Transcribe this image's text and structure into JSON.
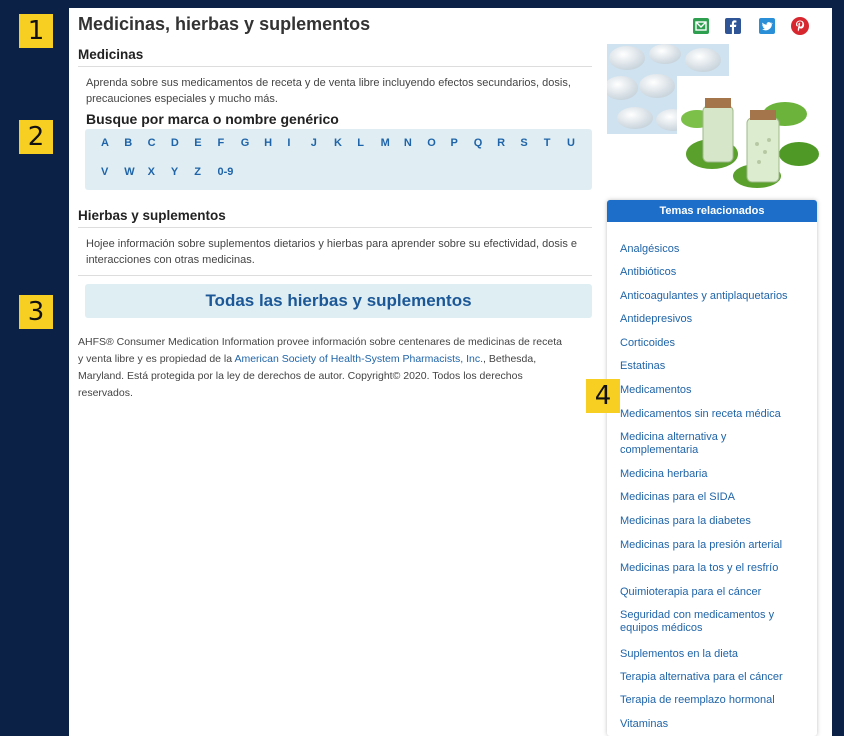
{
  "page": {
    "title": "Medicinas, hierbas y suplementos"
  },
  "markers": [
    "1",
    "2",
    "3",
    "4"
  ],
  "share_icons": [
    {
      "icon": "email-icon",
      "color": "#2e9e4f"
    },
    {
      "icon": "facebook-icon",
      "color": "#2f5597"
    },
    {
      "icon": "twitter-icon",
      "color": "#2b8fd8"
    },
    {
      "icon": "pinterest-icon",
      "color": "#d7262e"
    }
  ],
  "medicinas": {
    "heading": "Medicinas",
    "description": "Aprenda sobre sus medicamentos de receta y de venta libre incluyendo efectos secundarios, dosis, precauciones especiales y mucho más.",
    "search_heading": "Busque por marca o nombre genérico",
    "letters_row1": [
      "A",
      "B",
      "C",
      "D",
      "E",
      "F",
      "G",
      "H",
      "I",
      "J",
      "K",
      "L",
      "M",
      "N",
      "O",
      "P",
      "Q",
      "R",
      "S",
      "T",
      "U"
    ],
    "letters_row2": [
      "V",
      "W",
      "X",
      "Y",
      "Z",
      "0-9"
    ]
  },
  "hierbas": {
    "heading": "Hierbas y suplementos",
    "description": "Hojee información sobre suplementos dietarios y hierbas para aprender sobre su efectividad, dosis e interacciones con otras medicinas.",
    "all_button": "Todas las hierbas y suplementos"
  },
  "copyright": {
    "before": "AHFS® Consumer Medication Information provee información sobre centenares de medicinas de receta y venta libre y es propiedad de la ",
    "link": "American Society of Health-System Pharmacists, Inc.",
    "after": ", Bethesda, Maryland. Está protegida por la ley de derechos de autor. Copyright© 2020. Todos los derechos reservados."
  },
  "sidebar": {
    "heading": "Temas relacionados",
    "items": [
      "Analgésicos",
      "Antibióticos",
      "Anticoagulantes y antiplaquetarios",
      "Antidepresivos",
      "Corticoides",
      "Estatinas",
      "Medicamentos",
      "Medicamentos sin receta médica",
      "Medicina alternativa y complementaria",
      "Medicina herbaria",
      "Medicinas para el SIDA",
      "Medicinas para la diabetes",
      "Medicinas para la presión arterial",
      "Medicinas para la tos y el resfrío",
      "Quimioterapia para el cáncer",
      "Seguridad con medicamentos y equipos médicos",
      "Suplementos en la dieta",
      "Terapia alternativa para el cáncer",
      "Terapia de reemplazo hormonal",
      "Vitaminas"
    ]
  }
}
